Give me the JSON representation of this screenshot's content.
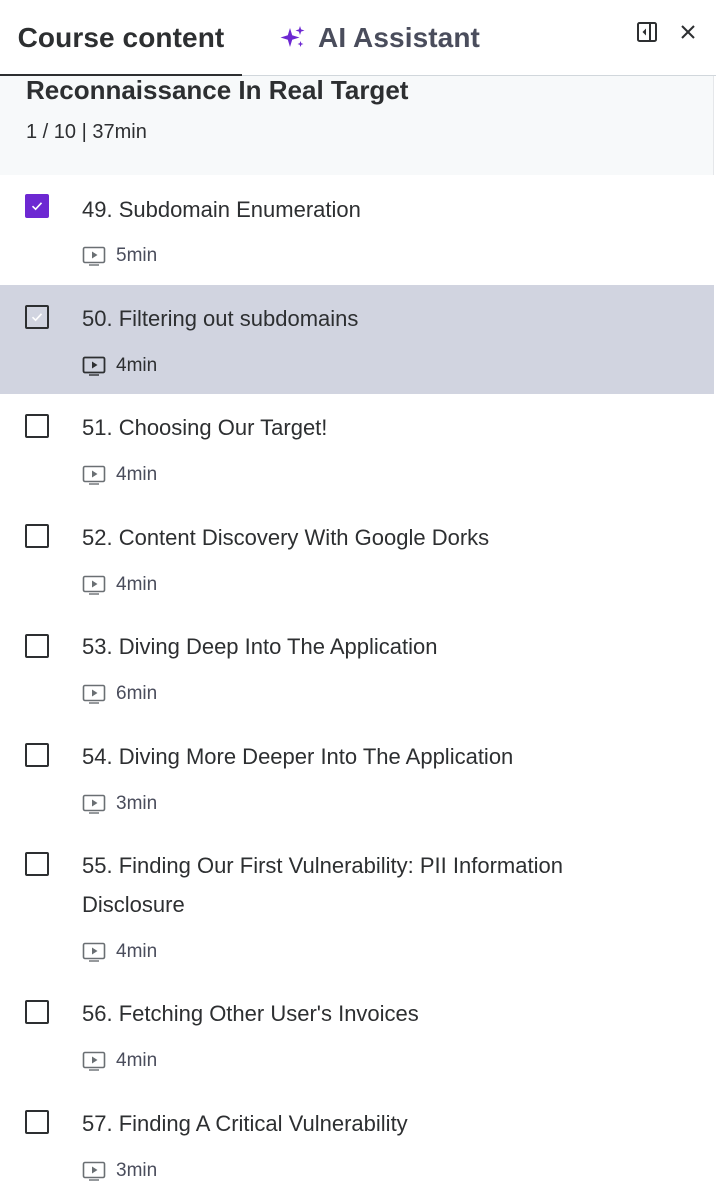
{
  "tabs": {
    "course_content": "Course content",
    "ai_assistant": "AI Assistant"
  },
  "icons": {
    "sparkle": "sparkle-icon",
    "collapse": "panel-collapse-icon",
    "close": "close-icon",
    "play": "video-play-icon"
  },
  "colors": {
    "accent": "#6d28d2",
    "active_row": "#d1d4e0",
    "section_bg": "#f7f9fa",
    "text": "#2d2f31"
  },
  "section": {
    "title": "Reconnaissance In Real Target",
    "meta": "1 / 10 | 37min"
  },
  "lectures": [
    {
      "title": "49. Subdomain Enumeration",
      "duration": "5min",
      "completed": true
    },
    {
      "title": "50. Filtering out subdomains",
      "duration": "4min",
      "completed": false,
      "current": true
    },
    {
      "title": "51. Choosing Our Target!",
      "duration": "4min",
      "completed": false
    },
    {
      "title": "52. Content Discovery With Google Dorks",
      "duration": "4min",
      "completed": false
    },
    {
      "title": "53. Diving Deep Into The Application",
      "duration": "6min",
      "completed": false
    },
    {
      "title": "54. Diving More Deeper Into The Application",
      "duration": "3min",
      "completed": false
    },
    {
      "title": "55. Finding Our First Vulnerability: PII Information Disclosure",
      "duration": "4min",
      "completed": false
    },
    {
      "title": "56. Fetching Other User's Invoices",
      "duration": "4min",
      "completed": false
    },
    {
      "title": "57. Finding A Critical Vulnerability",
      "duration": "3min",
      "completed": false
    }
  ]
}
